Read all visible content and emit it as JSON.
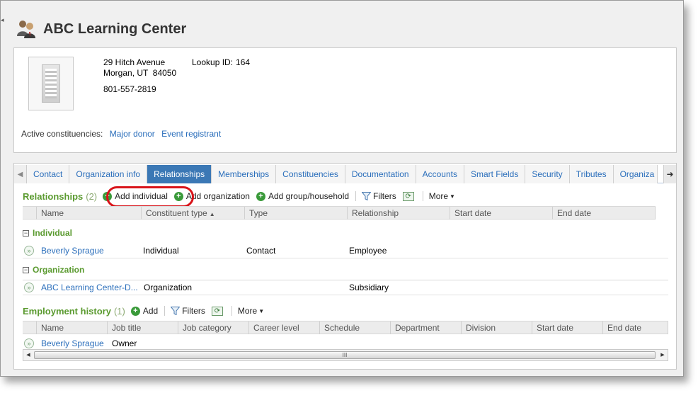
{
  "header": {
    "title": "ABC Learning Center",
    "icon": "constituent-group-icon"
  },
  "summary": {
    "address_line1": "29 Hitch Avenue",
    "address_line2": "Morgan, UT  84050",
    "phone": "801-557-2819",
    "lookup_label": "Lookup ID:",
    "lookup_value": "164",
    "constituencies_label": "Active constituencies:",
    "constituencies": [
      "Major donor",
      "Event registrant"
    ]
  },
  "tabs": [
    "Contact",
    "Organization info",
    "Relationships",
    "Memberships",
    "Constituencies",
    "Documentation",
    "Accounts",
    "Smart Fields",
    "Security",
    "Tributes",
    "Organiza"
  ],
  "active_tab": "Relationships",
  "relationships": {
    "title": "Relationships",
    "count": "(2)",
    "toolbar": {
      "add_individual": "Add individual",
      "add_organization": "Add organization",
      "add_group": "Add group/household",
      "filters": "Filters",
      "more": "More"
    },
    "columns": [
      "Name",
      "Constituent type",
      "Type",
      "Relationship",
      "Start date",
      "End date"
    ],
    "groups": [
      {
        "label": "Individual",
        "rows": [
          {
            "name": "Beverly Sprague",
            "constituent_type": "Individual",
            "type": "Contact",
            "relationship": "Employee",
            "start_date": "",
            "end_date": ""
          }
        ]
      },
      {
        "label": "Organization",
        "rows": [
          {
            "name": "ABC Learning Center-D...",
            "constituent_type": "Organization",
            "type": "",
            "relationship": "Subsidiary",
            "start_date": "",
            "end_date": ""
          }
        ]
      }
    ]
  },
  "employment": {
    "title": "Employment history",
    "count": "(1)",
    "toolbar": {
      "add": "Add",
      "filters": "Filters",
      "more": "More"
    },
    "columns": [
      "Name",
      "Job title",
      "Job category",
      "Career level",
      "Schedule",
      "Department",
      "Division",
      "Start date",
      "End date"
    ],
    "rows": [
      {
        "name": "Beverly Sprague",
        "job_title": "Owner"
      }
    ]
  },
  "scrollbar": {
    "grip": "III"
  },
  "colors": {
    "accent": "#3b78b5",
    "section_green": "#5a9a2f",
    "link": "#2a6ebb",
    "highlight": "#d8141a"
  }
}
